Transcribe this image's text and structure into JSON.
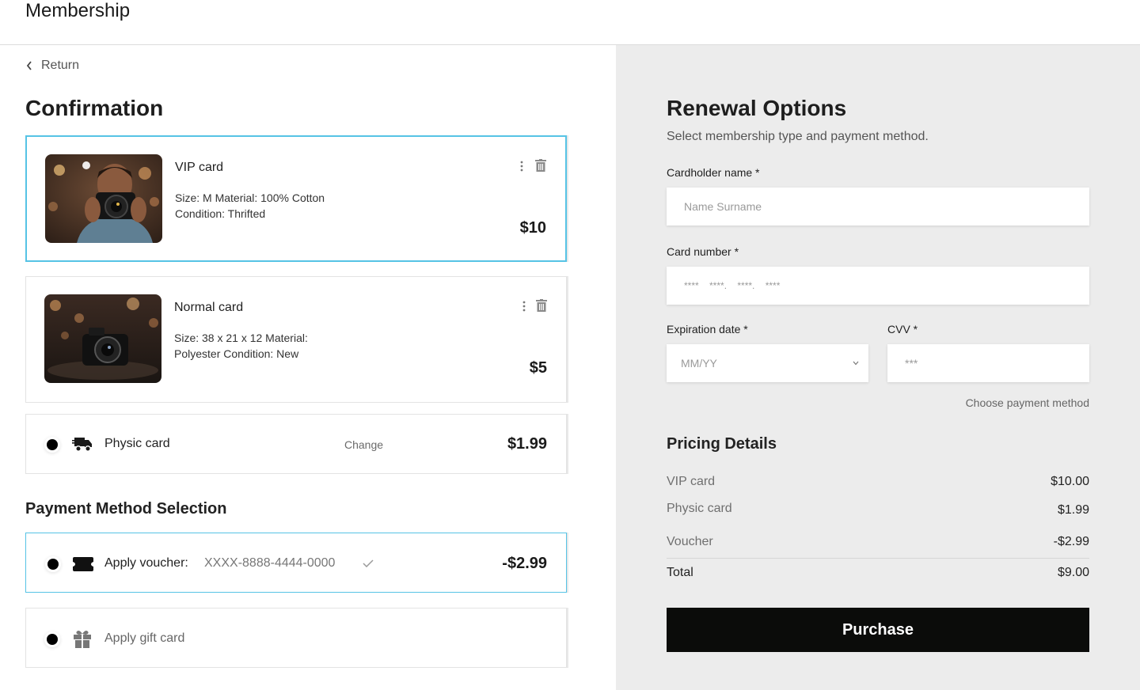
{
  "header": {
    "title": "Membership"
  },
  "left": {
    "return_label": "Return",
    "title": "Confirmation",
    "items": [
      {
        "name": "VIP card",
        "description": "Size: M Material: 100% Cotton Condition: Thrifted",
        "price": "$10"
      },
      {
        "name": "Normal card",
        "description": "Size: 38 x 21 x 12 Material: Polyester Condition: New",
        "price": "$5"
      }
    ],
    "shipping": {
      "label": "Physic card",
      "change_label": "Change",
      "price": "$1.99"
    },
    "payment_title": "Payment Method Selection",
    "voucher": {
      "label": "Apply voucher:",
      "code": "XXXX-8888-4444-0000",
      "price": "-$2.99"
    },
    "gift": {
      "label": "Apply gift card"
    }
  },
  "right": {
    "title": "Renewal Options",
    "subtitle": "Select membership type and payment method.",
    "cardholder": {
      "label": "Cardholder name *",
      "placeholder": "Name Surname"
    },
    "card_number": {
      "label": "Card number *",
      "placeholder": "****    ****.    ****.    ****"
    },
    "expiration": {
      "label": "Expiration date *",
      "placeholder": "MM/YY"
    },
    "cvv": {
      "label": "CVV *",
      "placeholder": "***"
    },
    "choose_payment": "Choose payment method",
    "pricing_title": "Pricing Details",
    "pricing": [
      {
        "label": "VIP card",
        "value": "$10.00"
      },
      {
        "label": "Physic card",
        "value": "$1.99"
      },
      {
        "label": "Voucher",
        "value": "-$2.99"
      }
    ],
    "total": {
      "label": "Total",
      "value": "$9.00"
    },
    "purchase_label": "Purchase"
  },
  "colors": {
    "accent": "#56c3e5",
    "button": "#0b0c0a",
    "panel": "#ececec"
  },
  "icons": [
    "chevron-left-icon",
    "kebab-menu-icon",
    "trash-icon",
    "delivery-truck-icon",
    "ticket-icon",
    "gift-icon",
    "check-icon",
    "chevron-down-icon"
  ]
}
